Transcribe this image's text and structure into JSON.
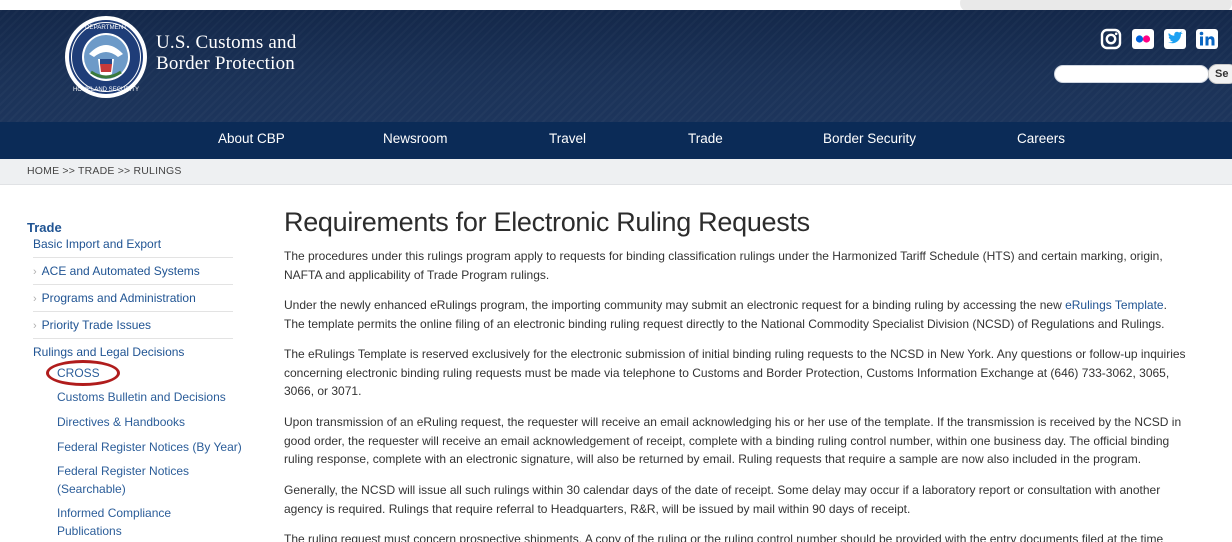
{
  "brand": {
    "line1": "U.S. Customs and",
    "line2": "Border Protection"
  },
  "header": {
    "social_icons": [
      "instagram-icon",
      "flickr-icon",
      "twitter-icon",
      "linkedin-icon"
    ],
    "search_button_label": "Se"
  },
  "nav": {
    "items": [
      "About CBP",
      "Newsroom",
      "Travel",
      "Trade",
      "Border Security",
      "Careers"
    ]
  },
  "breadcrumb": "HOME >> TRADE >> RULINGS",
  "sidebar": {
    "heading": "Trade",
    "items": [
      "Basic Import and Export",
      "ACE and Automated Systems",
      "Programs and Administration",
      "Priority Trade Issues",
      "Rulings and Legal Decisions"
    ],
    "subitems": [
      "CROSS",
      "Customs Bulletin and Decisions",
      "Directives & Handbooks",
      "Federal Register Notices (By Year)",
      "Federal Register Notices",
      "(Searchable)",
      "Informed Compliance",
      "Publications"
    ]
  },
  "main": {
    "title": "Requirements for Electronic Ruling Requests",
    "p1_line1": "The procedures under this rulings program apply to requests for binding classification rulings under the Harmonized Tariff Schedule (HTS) and certain marking, origin,",
    "p1_line2": "NAFTA and applicability of Trade Program rulings.",
    "p2_line1_pre": "Under the newly enhanced eRulings program, the importing community may submit an electronic request for a binding ruling by accessing the new ",
    "p2_link": "eRulings Template",
    "p2_line1_post": ".",
    "p2_line2": "The template permits the online filing of an electronic binding ruling request directly to the National Commodity Specialist Division (NCSD) of Regulations and Rulings.",
    "p3_line1": "The eRulings Template is reserved exclusively for the electronic submission of initial binding ruling requests to the NCSD in New York. Any questions or follow-up inquiries",
    "p3_line2": "concerning electronic binding ruling requests must be made via telephone to Customs and Border Protection, Customs Information Exchange at (646) 733-3062, 3065,",
    "p3_line3": "3066, or 3071.",
    "p4_line1": "Upon transmission of an eRuling request, the requester will receive an email acknowledging his or her use of the template. If the transmission is received by the NCSD in",
    "p4_line2": "good order, the requester will receive an email acknowledgement of receipt, complete with a binding ruling control number, within one business day. The official binding",
    "p4_line3": "ruling response, complete with an electronic signature, will also be returned by email. Ruling requests that require a sample are now also included in the program.",
    "p5_line1": "Generally, the NCSD will issue all such rulings within 30 calendar days of the date of receipt. Some delay may occur if a laboratory report or consultation with another",
    "p5_line2": "agency is required. Rulings that require referral to Headquarters, R&R, will be issued by mail within 90 days of receipt.",
    "p6_line1": "The ruling request must concern prospective shipments. A copy of the ruling or the ruling control number should be provided with the entry documents filed at the time"
  },
  "colors": {
    "header_bg": "#1b3257",
    "nav_bg": "#0b2b57",
    "link": "#205493",
    "highlight_oval": "#b01c1c"
  }
}
